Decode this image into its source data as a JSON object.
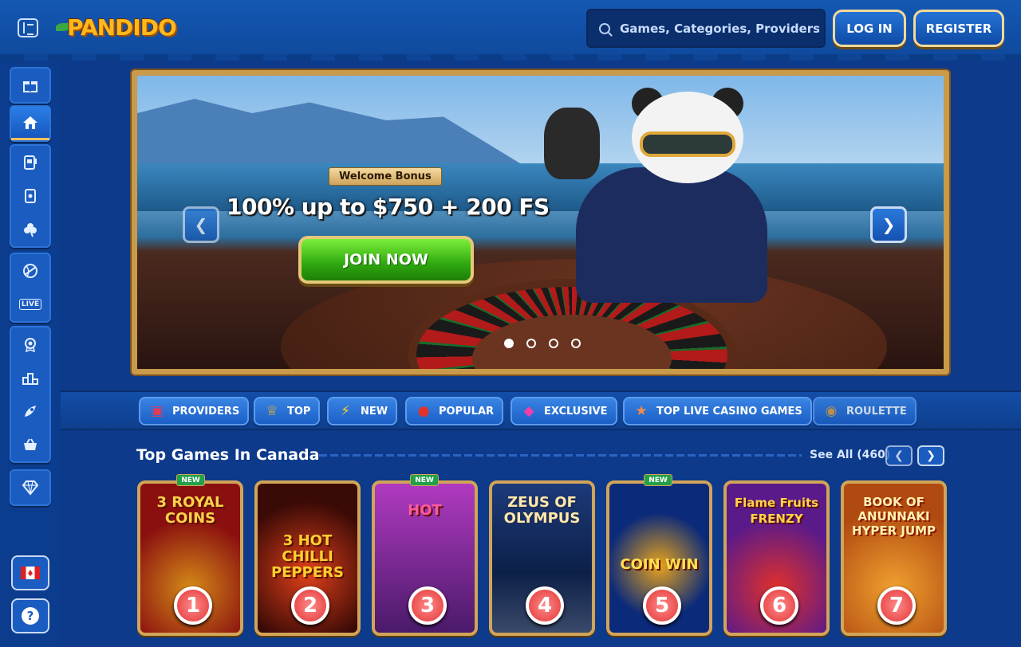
{
  "header": {
    "logo": "PANDIDO",
    "search_placeholder": "Games, Categories, Providers",
    "login_label": "LOG IN",
    "register_label": "REGISTER"
  },
  "sidebar": {
    "items": [
      {
        "icon": "gift-icon"
      },
      {
        "icon": "home-icon",
        "active": true
      },
      {
        "icon": "slot-machine-icon"
      },
      {
        "icon": "cards-icon"
      },
      {
        "icon": "clover-icon"
      },
      {
        "icon": "basketball-icon"
      },
      {
        "icon": "live-icon",
        "label": "LIVE"
      },
      {
        "icon": "badge-icon"
      },
      {
        "icon": "podium-icon"
      },
      {
        "icon": "rocket-icon"
      },
      {
        "icon": "basket-icon"
      },
      {
        "icon": "diamond-icon"
      }
    ],
    "country_icon": "canada-flag-icon",
    "help_label": "?"
  },
  "banner": {
    "tag": "Welcome Bonus",
    "headline": "100% up to $750 + 200 FS",
    "cta": "JOIN NOW",
    "slides": 4,
    "active_slide": 1
  },
  "categories": [
    {
      "label": "PROVIDERS",
      "icon": "book-icon"
    },
    {
      "label": "TOP",
      "icon": "crown-icon"
    },
    {
      "label": "NEW",
      "icon": "lightning-icon"
    },
    {
      "label": "POPULAR",
      "icon": "apple-icon"
    },
    {
      "label": "EXCLUSIVE",
      "icon": "gem-icon"
    },
    {
      "label": "TOP LIVE CASINO GAMES",
      "icon": "starfish-icon"
    },
    {
      "label": "ROULETTE",
      "icon": "roulette-icon"
    }
  ],
  "top_games": {
    "title": "Top Games In Canada",
    "see_all": "See All (460)",
    "games": [
      {
        "name": "3 ROYAL COINS",
        "rank": "1",
        "new": true,
        "bg": "#8a0f0f"
      },
      {
        "name": "3 HOT CHILLI PEPPERS",
        "rank": "2",
        "new": false,
        "bg": "#6a1208"
      },
      {
        "name": "HOT",
        "rank": "3",
        "new": true,
        "bg": "#7a2a8a"
      },
      {
        "name": "ZEUS OF OLYMPUS",
        "rank": "4",
        "new": false,
        "bg": "#0f3a6a"
      },
      {
        "name": "COIN WIN",
        "rank": "5",
        "new": true,
        "bg": "#0b2a7a"
      },
      {
        "name": "Flame Fruits FRENZY",
        "rank": "6",
        "new": false,
        "bg": "#5a1a8a"
      },
      {
        "name": "BOOK OF ANUNNAKI HYPER JUMP",
        "rank": "7",
        "new": false,
        "bg": "#b04a10"
      }
    ],
    "new_label": "NEW"
  }
}
